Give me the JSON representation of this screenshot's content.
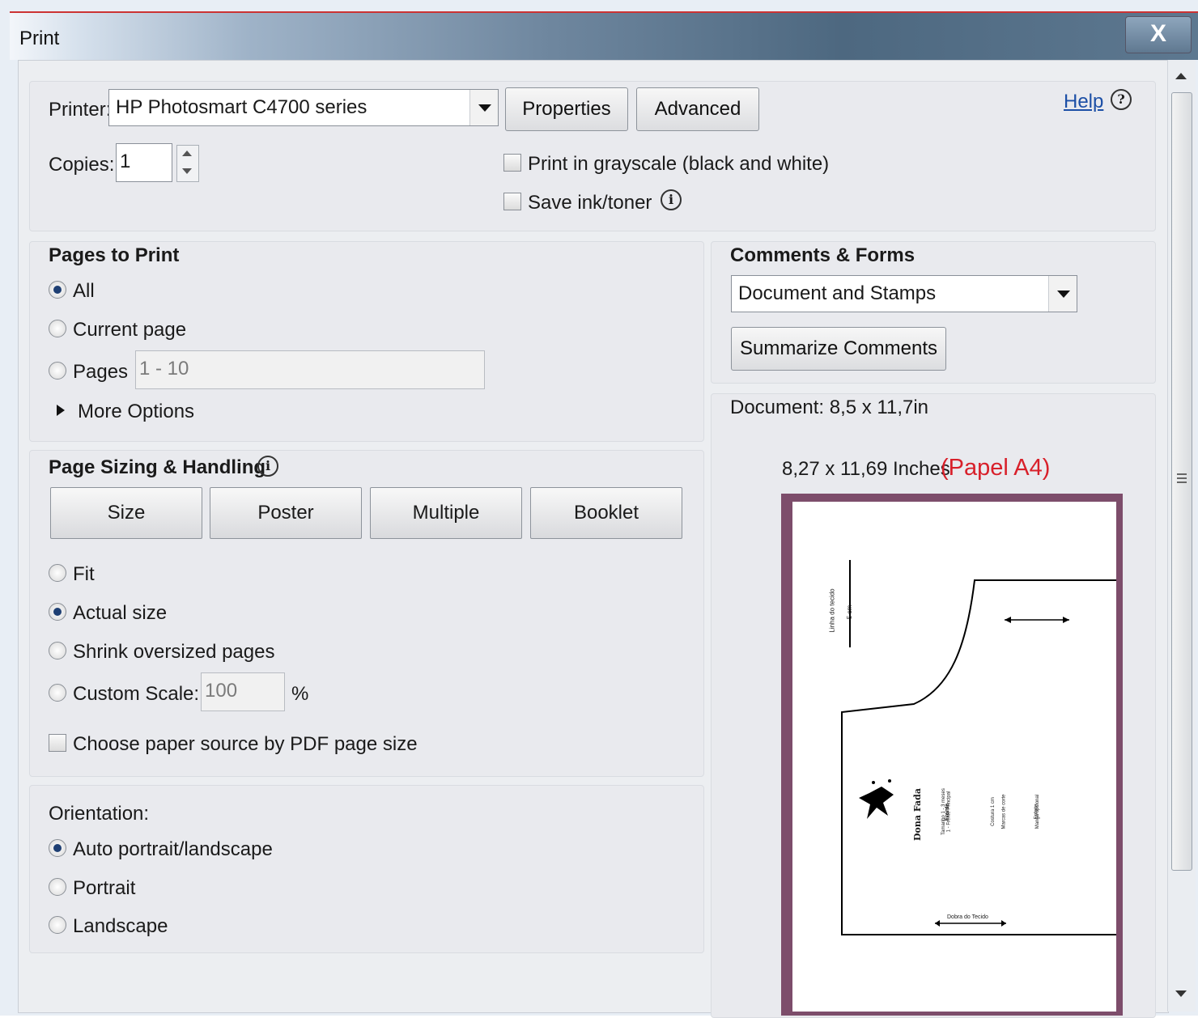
{
  "window": {
    "title": "Print",
    "close_label": "X"
  },
  "printer": {
    "label": "Printer:",
    "value": "HP Photosmart C4700 series",
    "properties_label": "Properties",
    "advanced_label": "Advanced",
    "help_label": "Help"
  },
  "copies": {
    "label": "Copies:",
    "value": "1"
  },
  "options": {
    "grayscale_label": "Print in grayscale (black and white)",
    "grayscale_checked": false,
    "save_ink_label": "Save ink/toner",
    "save_ink_checked": false
  },
  "pages_to_print": {
    "heading": "Pages to Print",
    "all_label": "All",
    "current_label": "Current page",
    "pages_label": "Pages",
    "pages_value": "1 - 10",
    "more_options_label": "More Options",
    "selected": "All"
  },
  "sizing": {
    "heading": "Page Sizing & Handling",
    "tabs": [
      "Size",
      "Poster",
      "Multiple",
      "Booklet"
    ],
    "fit_label": "Fit",
    "actual_label": "Actual size",
    "shrink_label": "Shrink oversized pages",
    "custom_label": "Custom Scale:",
    "custom_value": "100",
    "percent": "%",
    "paper_source_label": "Choose paper source by PDF page size",
    "selected": "Actual size"
  },
  "orientation": {
    "heading": "Orientation:",
    "auto_label": "Auto portrait/landscape",
    "portrait_label": "Portrait",
    "landscape_label": "Landscape",
    "selected": "Auto portrait/landscape"
  },
  "comments": {
    "heading": "Comments & Forms",
    "value": "Document and Stamps",
    "summarize_label": "Summarize Comments"
  },
  "document": {
    "label": "Document: 8,5 x 11,7in",
    "paper_size": "8,27 x 11,69 Inches",
    "annotation": "(Papel A4)",
    "annotation_color": "#d8202a"
  },
  "preview": {
    "vertical_label_1": "Linha do tecido",
    "vertical_label_2": "5 cm",
    "brand": "Dona Fada",
    "bottom_label": "Dobra do Tecido",
    "col1": "Frente",
    "col2_1": "Tamanho 1 - 3 meses",
    "col2_2": "1 - Frente Principal",
    "col3_1": "Costura 1 cm",
    "col3_2": "Marcas de corte",
    "col4_1": "Manga opcional",
    "col4_2": "Enfeite"
  }
}
